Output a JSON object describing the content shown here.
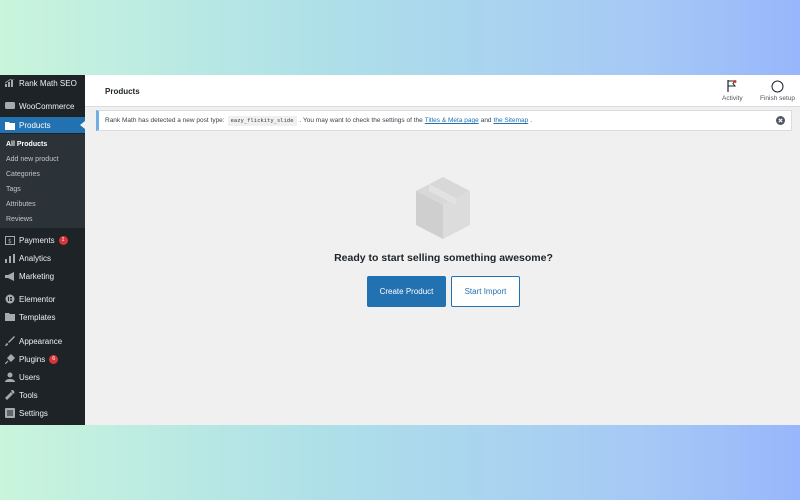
{
  "sidebar": {
    "items": [
      {
        "key": "rankmath",
        "label": "Rank Math SEO",
        "icon": "rank-math-icon"
      },
      {
        "key": "woocommerce",
        "label": "WooCommerce",
        "icon": "woocommerce-icon"
      },
      {
        "key": "products",
        "label": "Products",
        "icon": "products-icon"
      },
      {
        "key": "payments",
        "label": "Payments",
        "icon": "payments-icon",
        "badge": "1"
      },
      {
        "key": "analytics",
        "label": "Analytics",
        "icon": "analytics-icon"
      },
      {
        "key": "marketing",
        "label": "Marketing",
        "icon": "megaphone-icon"
      },
      {
        "key": "elementor",
        "label": "Elementor",
        "icon": "elementor-icon"
      },
      {
        "key": "templates",
        "label": "Templates",
        "icon": "folder-icon"
      },
      {
        "key": "appearance",
        "label": "Appearance",
        "icon": "paintbrush-icon"
      },
      {
        "key": "plugins",
        "label": "Plugins",
        "icon": "plugin-icon",
        "badge": "6"
      },
      {
        "key": "users",
        "label": "Users",
        "icon": "users-icon"
      },
      {
        "key": "tools",
        "label": "Tools",
        "icon": "wrench-icon"
      },
      {
        "key": "settings",
        "label": "Settings",
        "icon": "settings-icon"
      }
    ],
    "submenu": [
      "All Products",
      "Add new product",
      "Categories",
      "Tags",
      "Attributes",
      "Reviews"
    ]
  },
  "topbar": {
    "title": "Products",
    "activity": "Activity",
    "finish_setup": "Finish setup"
  },
  "notice": {
    "text_before": "Rank Math has detected a new post type:",
    "post_type": "eazy_flickity_slide",
    "text_middle": ". You may want to check the settings of the",
    "link_titles": "Titles & Meta page",
    "text_and": "and",
    "link_sitemap": "the Sitemap",
    "text_end": "."
  },
  "empty_state": {
    "message": "Ready to start selling something awesome?",
    "create_label": "Create Product",
    "import_label": "Start Import"
  },
  "colors": {
    "sidebar_bg": "#1d2327",
    "accent": "#2271b1",
    "badge": "#d63638"
  }
}
